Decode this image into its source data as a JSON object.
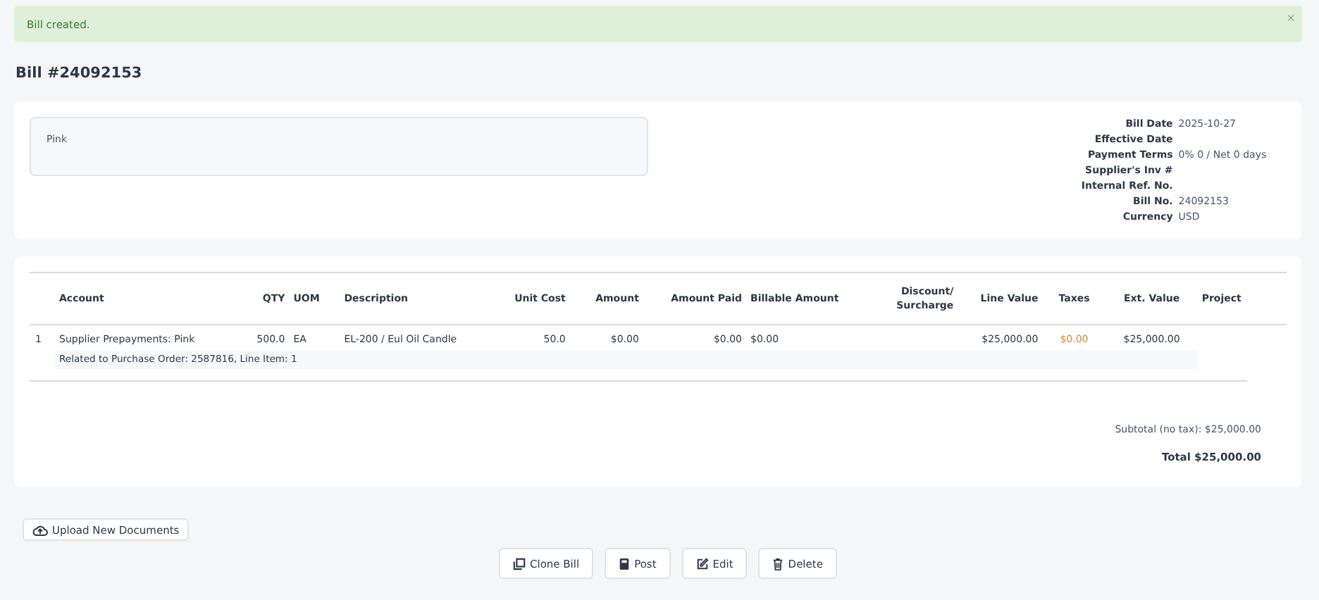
{
  "alert": {
    "message": "Bill created.",
    "close": "×"
  },
  "title": "Bill #24092153",
  "memo": "Pink",
  "details": [
    {
      "label": "Bill Date",
      "value": "2025-10-27"
    },
    {
      "label": "Effective Date"
    },
    {
      "label": "Payment Terms",
      "value": "0% 0 / Net 0 days"
    },
    {
      "label": "Supplier's Inv #"
    },
    {
      "label": "Internal Ref. No."
    },
    {
      "label": "Bill No.",
      "value": "24092153"
    },
    {
      "label": "Currency",
      "value": "USD"
    }
  ],
  "table": {
    "columns": [
      "Account",
      "QTY",
      "UOM",
      "Description",
      "Unit Cost",
      "Amount",
      "Amount Paid",
      "Billable Amount",
      "Discount/ Surcharge",
      "Line Value",
      "Taxes",
      "Ext. Value",
      "Project"
    ],
    "rows": [
      {
        "number": "1",
        "cells": [
          "Supplier Prepayments: Pink",
          "500.0",
          "EA",
          "EL-200 / Eul Oil Candle",
          "50.0",
          "$0.00",
          "$0.00",
          "$0.00",
          null,
          "$25,000.00",
          "$0.00",
          "$25,000.00",
          null
        ],
        "note": "Related to Purchase Order: 2587816, Line Item: 1"
      }
    ]
  },
  "subtotal": "Subtotal (no tax): $25,000.00",
  "total": "Total $25,000.00",
  "upload_button": "Upload New Documents",
  "actions": [
    "Clone Bill",
    "Post",
    "Edit",
    "Delete"
  ]
}
